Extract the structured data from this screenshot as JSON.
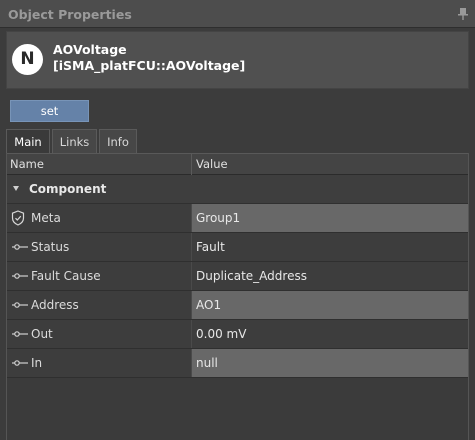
{
  "panel": {
    "title": "Object Properties",
    "pin_icon": "pin-icon"
  },
  "object": {
    "logo_letter": "N",
    "name": "AOVoltage",
    "path": "[iSMA_platFCU::AOVoltage]"
  },
  "actions": {
    "set_label": "set"
  },
  "tabs": [
    {
      "label": "Main",
      "active": true
    },
    {
      "label": "Links",
      "active": false
    },
    {
      "label": "Info",
      "active": false
    }
  ],
  "grid": {
    "columns": {
      "name": "Name",
      "value": "Value"
    },
    "group": {
      "label": "Component",
      "icon": "caret-down-icon"
    },
    "rows": [
      {
        "label": "Meta",
        "value": "Group1",
        "icon": "shield-icon",
        "editable": true
      },
      {
        "label": "Status",
        "value": "Fault",
        "icon": "slot-icon",
        "editable": false
      },
      {
        "label": "Fault Cause",
        "value": "Duplicate_Address",
        "icon": "slot-icon",
        "editable": false
      },
      {
        "label": "Address",
        "value": "AO1",
        "icon": "slot-icon",
        "editable": true
      },
      {
        "label": "Out",
        "value": "0.00 mV",
        "icon": "slot-icon",
        "editable": false
      },
      {
        "label": "In",
        "value": "null",
        "icon": "slot-icon",
        "editable": true
      }
    ]
  },
  "colors": {
    "background": "#3c3c3c",
    "header": "#4d4d4d",
    "button": "#6582a8",
    "editable_cell": "#686868"
  }
}
